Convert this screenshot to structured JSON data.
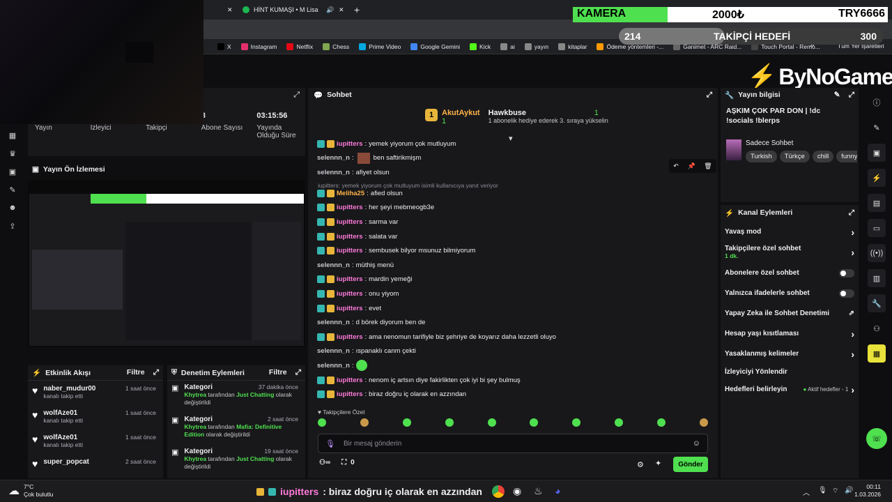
{
  "browser": {
    "tab_title": "HİNT KUMAŞI • M Lisa",
    "bookmarks": [
      "X",
      "Instagram",
      "Netflix",
      "Chess",
      "Prime Video",
      "Google Gemini",
      "Kick",
      "ai",
      "yayın",
      "kitaplar",
      "Ödeme yöntemleri -...",
      "Ganimet - ARC Raid...",
      "Touch Portal - Remo..."
    ],
    "all_bookmarks": "Tüm Yer İşaretleri"
  },
  "overlay": {
    "camera_label": "KAMERA",
    "camera_amount": "2000₺",
    "camera_target": "TRY6666",
    "camera_progress": 0.3,
    "follower_start": "214",
    "follower_label": "TAKİPÇİ HEDEFİ",
    "follower_end": "300",
    "follower_progress": 0.4,
    "logo": "ByNoGame"
  },
  "stats": {
    "items": [
      {
        "label": "Yayın",
        "value": ""
      },
      {
        "label": "İzleyici",
        "value": ""
      },
      {
        "label": "Takipçi",
        "value": ""
      },
      {
        "label": "Abone Sayısı",
        "value": "8"
      },
      {
        "label": "Yayında Olduğu Süre",
        "value": "03:15:56"
      }
    ]
  },
  "preview": {
    "title": "Yayın Ön İzlemesi"
  },
  "activity": {
    "title": "Etkinlik Akışı",
    "filter": "Filtre",
    "items": [
      {
        "name": "naber_mudur00",
        "sub": "kanalı takip etti",
        "time": "1 saat önce"
      },
      {
        "name": "wolfAze01",
        "sub": "kanalı takip etti",
        "time": "1 saat önce"
      },
      {
        "name": "wolfAze01",
        "sub": "kanalı takip etti",
        "time": "1 saat önce"
      },
      {
        "name": "super_popcat",
        "sub": "",
        "time": "2 saat önce"
      }
    ]
  },
  "moderation": {
    "title": "Denetim Eylemleri",
    "filter": "Filtre",
    "items": [
      {
        "name": "Kategori",
        "actor": "Khytrea",
        "mid": "tarafından",
        "cat": "Just Chatting",
        "end": "olarak değiştirildi",
        "time": "37 dakika önce"
      },
      {
        "name": "Kategori",
        "actor": "Khytrea",
        "mid": "tarafından",
        "cat": "Mafia: Definitive Edition",
        "end": "olarak değiştirildi",
        "time": "2 saat önce"
      },
      {
        "name": "Kategori",
        "actor": "Khytrea",
        "mid": "tarafından",
        "cat": "Just Chatting",
        "end": "olarak değiştirildi",
        "time": "19 saat önce"
      }
    ]
  },
  "chat": {
    "title": "Sohbet",
    "pinned_user1": "AkutAykut",
    "pinned_count1": "1",
    "pinned_user2": "Hawkbuse",
    "pinned_count2": "1",
    "pinned_note": "1 abonelik hediye ederek 3. sıraya yükselin",
    "reply_note": "iupitters: yemek yiyorum çok mutluyum isimli kullanıcıya yanıt veriyor",
    "messages": [
      {
        "user": "iupitters",
        "text": "yemek yiyorum çok mutluyum",
        "style": "pink",
        "badges": true
      },
      {
        "user": "selennn_n",
        "text": "ben saftirikmişm",
        "style": "gray",
        "badges": false,
        "emote": true
      },
      {
        "user": "selennn_n",
        "text": "afiyet olsun",
        "style": "gray",
        "badges": false
      }
    ],
    "messages2": [
      {
        "user": "Meliha25",
        "text": "afied olsun",
        "style": "yel",
        "badges": true
      },
      {
        "user": "iupitters",
        "text": "her şeyi mebmeogb3e",
        "style": "pink",
        "badges": true
      },
      {
        "user": "iupitters",
        "text": "sarma var",
        "style": "pink",
        "badges": true
      },
      {
        "user": "iupitters",
        "text": "salata var",
        "style": "pink",
        "badges": true
      },
      {
        "user": "iupitters",
        "text": "sembusek bilyor msunuz bilmiyorum",
        "style": "pink",
        "badges": true
      },
      {
        "user": "selennn_n",
        "text": "müthiş menü",
        "style": "gray",
        "badges": false
      },
      {
        "user": "iupitters",
        "text": "mardin yemeği",
        "style": "pink",
        "badges": true
      },
      {
        "user": "iupitters",
        "text": "onu yiyom",
        "style": "pink",
        "badges": true
      },
      {
        "user": "iupitters",
        "text": "evet",
        "style": "pink",
        "badges": true
      },
      {
        "user": "selennn_n",
        "text": "d börek diyorum ben de",
        "style": "gray",
        "badges": false
      },
      {
        "user": "iupitters",
        "text": "ama nenomun tarifiyle biz şehriye de koyarız daha lezzetli oluyo",
        "style": "pink",
        "badges": true
      },
      {
        "user": "selennn_n",
        "text": "ıspanaklı canm çekti",
        "style": "gray",
        "badges": false
      },
      {
        "user": "selennn_n",
        "text": "",
        "style": "gray",
        "badges": false,
        "emoji": true
      },
      {
        "user": "iupitters",
        "text": "nenom iç artsın diye fakirlikten çok iyi bi şey bulmuş",
        "style": "pink",
        "badges": true
      },
      {
        "user": "iupitters",
        "text": "biraz doğru iç olarak en azzından",
        "style": "pink",
        "badges": true
      }
    ],
    "followers_only": "Takipçilere Özel",
    "input_placeholder": "Bir mesaj gönderin",
    "points": "0",
    "send": "Gönder"
  },
  "stream_info": {
    "title": "Yayın bilgisi",
    "stream_title": "AŞKIM ÇOK PAR DON | !dc !socials !blerps",
    "category": "Sadece Sohbet",
    "tags": [
      "Turkish",
      "Türkçe",
      "chill",
      "funny"
    ]
  },
  "channel_actions": {
    "title": "Kanal Eylemleri",
    "slow_mode": "Yavaş mod",
    "followers_chat": "Takipçilere özel sohbet",
    "followers_chat_sub": "1 dk.",
    "subs_chat": "Abonelere özel sohbet",
    "emote_chat": "Yalnızca ifadelerle sohbet",
    "ai_mod": "Yapay Zeka ile Sohbet Denetimi",
    "age_limit": "Hesap yaşı kısıtlaması",
    "banned_words": "Yasaklanmış kelimeler",
    "redirect": "İzleyiciyi Yönlendir",
    "goals": "Hedefleri belirleyin",
    "goals_status": "Aktif hedefler - 1"
  },
  "taskbar": {
    "weather_temp": "7°C",
    "weather_desc": "Çok bulutlu",
    "ticker_user": "iupitters",
    "ticker_text": ": biraz doğru iç olarak en azzından",
    "time": "00:11",
    "date": "1.03.2026"
  },
  "colors": {
    "accent": "#4fe04f",
    "panel": "#18181b",
    "bg": "#0e0e10"
  }
}
